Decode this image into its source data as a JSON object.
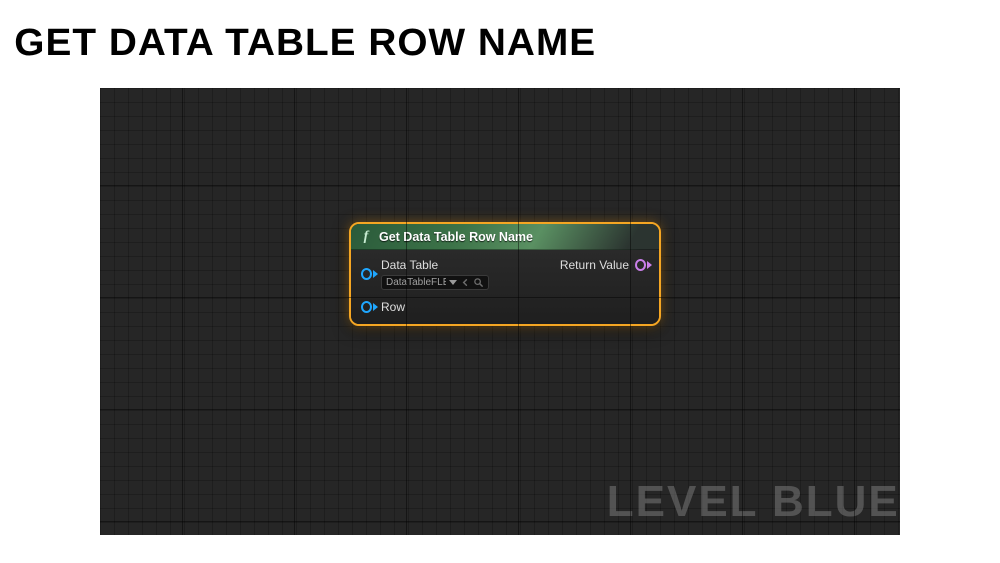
{
  "page": {
    "title": "GET DATA TABLE ROW NAME"
  },
  "canvas": {
    "watermark": "LEVEL BLUEI"
  },
  "node": {
    "title": "Get Data Table Row Name",
    "inputs": {
      "data_table": {
        "label": "Data Table",
        "value": "DataTableFLExam"
      },
      "row": {
        "label": "Row"
      }
    },
    "outputs": {
      "return_value": {
        "label": "Return Value"
      }
    }
  }
}
